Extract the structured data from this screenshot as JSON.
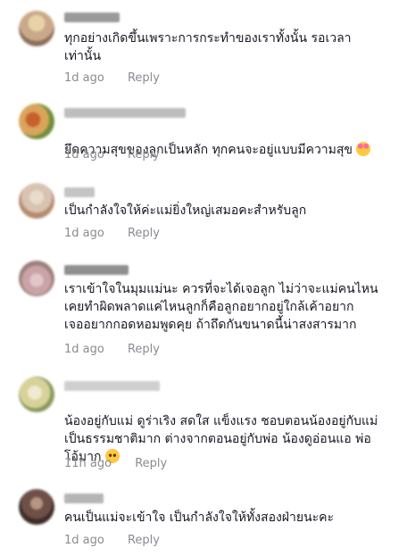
{
  "comments": [
    {
      "text": "ทุกอย่างเกิดขึ้นเพราะการกระทำของเราทั้งนั้น รอเวลา\nเท่านั้น",
      "time": "1d ago",
      "reply": "Reply",
      "avatar_colors": [
        "#c9a98a",
        "#e8d3a6",
        "#8c6f5a"
      ],
      "username_color": "#9a9a9a"
    },
    {
      "text": "ยึดความสุขของลูกเป็นหลัก ทุกคนจะอยู่แบบมีความสุข",
      "emoji": "smiling-face-with-hearts",
      "time": "1d ago",
      "reply": "Reply",
      "avatar_colors": [
        "#d9a55a",
        "#6f8f3a",
        "#c8602e"
      ],
      "username_color": "#bdbdbd"
    },
    {
      "text": "เป็นกำลังใจให้ค่ะแม่ยิ่งใหญ่เสมอคะสำหรับลูก",
      "time": "1d ago",
      "reply": "Reply",
      "avatar_colors": [
        "#d8c3b0",
        "#b48b70",
        "#e9dccd"
      ],
      "username_color": "#c4c4c4"
    },
    {
      "text": "เราเข้าใจในมุมแม่นะ ควรที่จะได้เจอลูก ไม่ว่าจะแม่คนไหน\nเคยทำผิดพลาดแค่ไหนลูกก็คือลูกอยากอยู่ใกล้เค้าอยาก\nเจออยากกอดหอมพูดคุย ถ้าถึดกันขนาดนี้น่าสงสารมาก",
      "time": "1d ago",
      "reply": "Reply",
      "avatar_colors": [
        "#c9a3a8",
        "#e3c6c9",
        "#9b7f7a"
      ],
      "username_color": "#8f8f8f"
    },
    {
      "text": "น้องอยู่กับแม่ ดูร่าเริง สดใส แข็งแรง ชอบตอนน้องอยู่กับแม่\nเป็นธรรมชาติมาก ต่างจากตอนอยู่กับพ่อ น้องดูอ่อนแอ พ่อ\nโอ้มาก",
      "emoji": "pleading-face",
      "time": "11h ago",
      "reply": "Reply",
      "avatar_colors": [
        "#d8d29a",
        "#8a9a5a",
        "#f0ead0"
      ],
      "username_color": "#cfcfcf"
    },
    {
      "text": "คนเป็นแม่จะเข้าใจ เป็นกำลังใจให้ทั้งสองฝ่ายนะคะ",
      "time": "1d ago",
      "reply": "Reply",
      "avatar_colors": [
        "#6e5048",
        "#b89482",
        "#3e2c28"
      ],
      "username_color": "#b5b5b5"
    }
  ]
}
